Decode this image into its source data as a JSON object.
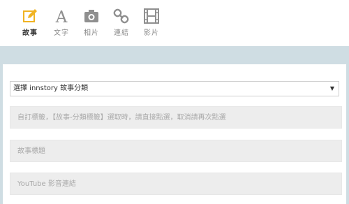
{
  "tabs": [
    {
      "label": "故事",
      "icon": "edit-icon",
      "active": true
    },
    {
      "label": "文字",
      "icon": "text-icon",
      "active": false
    },
    {
      "label": "相片",
      "icon": "camera-icon",
      "active": false
    },
    {
      "label": "連結",
      "icon": "link-icon",
      "active": false
    },
    {
      "label": "影片",
      "icon": "film-icon",
      "active": false
    }
  ],
  "form": {
    "category_select": "選擇 innstory 故事分類",
    "tags_placeholder": "自訂標籤，【故事-分類標籤】選取時，請直接點選，取消請再次點選",
    "title_placeholder": "故事標題",
    "youtube_placeholder": "YouTube 影音連結"
  },
  "colors": {
    "accent": "#f0b322",
    "icon_gray": "#8f8f8f",
    "band": "#cfdde3"
  }
}
